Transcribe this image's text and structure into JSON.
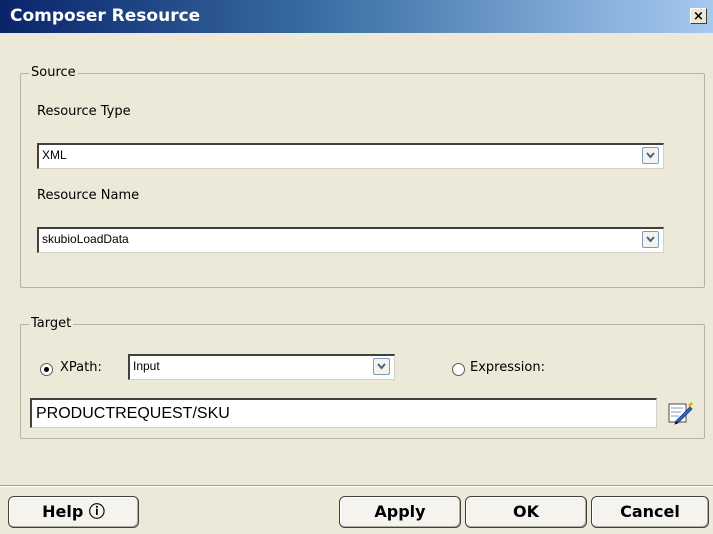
{
  "window": {
    "title": "Composer Resource",
    "close_glyph": "✕"
  },
  "source": {
    "legend": "Source",
    "resource_type_label": "Resource Type",
    "resource_type_value": "XML",
    "resource_name_label": "Resource Name",
    "resource_name_value": "skubioLoadData"
  },
  "target": {
    "legend": "Target",
    "xpath_label": "XPath:",
    "xpath_selected": true,
    "xpath_value": "Input",
    "expression_label": "Expression:",
    "expression_selected": false,
    "path_value": "PRODUCTREQUEST/SKU"
  },
  "buttons": {
    "help": "Help ⓘ",
    "apply": "Apply",
    "ok": "OK",
    "cancel": "Cancel"
  }
}
